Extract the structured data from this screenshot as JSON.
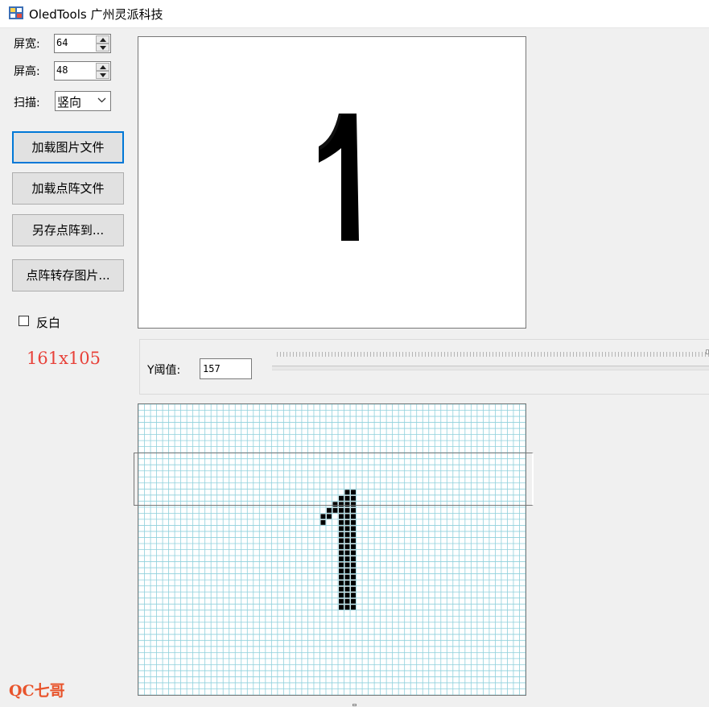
{
  "window": {
    "title": "OledTools 广州灵派科技"
  },
  "settings": {
    "width_label": "屏宽:",
    "width_value": "64",
    "height_label": "屏高:",
    "height_value": "48",
    "scan_label": "扫描:",
    "scan_value": "竖向"
  },
  "buttons": {
    "load_image": "加载图片文件",
    "load_dotmatrix": "加载点阵文件",
    "save_dotmatrix": "另存点阵到...",
    "dotmatrix_to_image": "点阵转存图片..."
  },
  "invert": {
    "label": "反白",
    "checked": false
  },
  "image_size": "161x105",
  "threshold": {
    "label": "Y阈值:",
    "value": "157"
  },
  "dot_matrix": {
    "cols": 64,
    "rows": 48
  },
  "watermark": "QC七哥",
  "colors": {
    "focus": "#0078d7",
    "grid_line": "#8fd0dc",
    "size_label": "#e8423a",
    "watermark": "#e8542c"
  }
}
